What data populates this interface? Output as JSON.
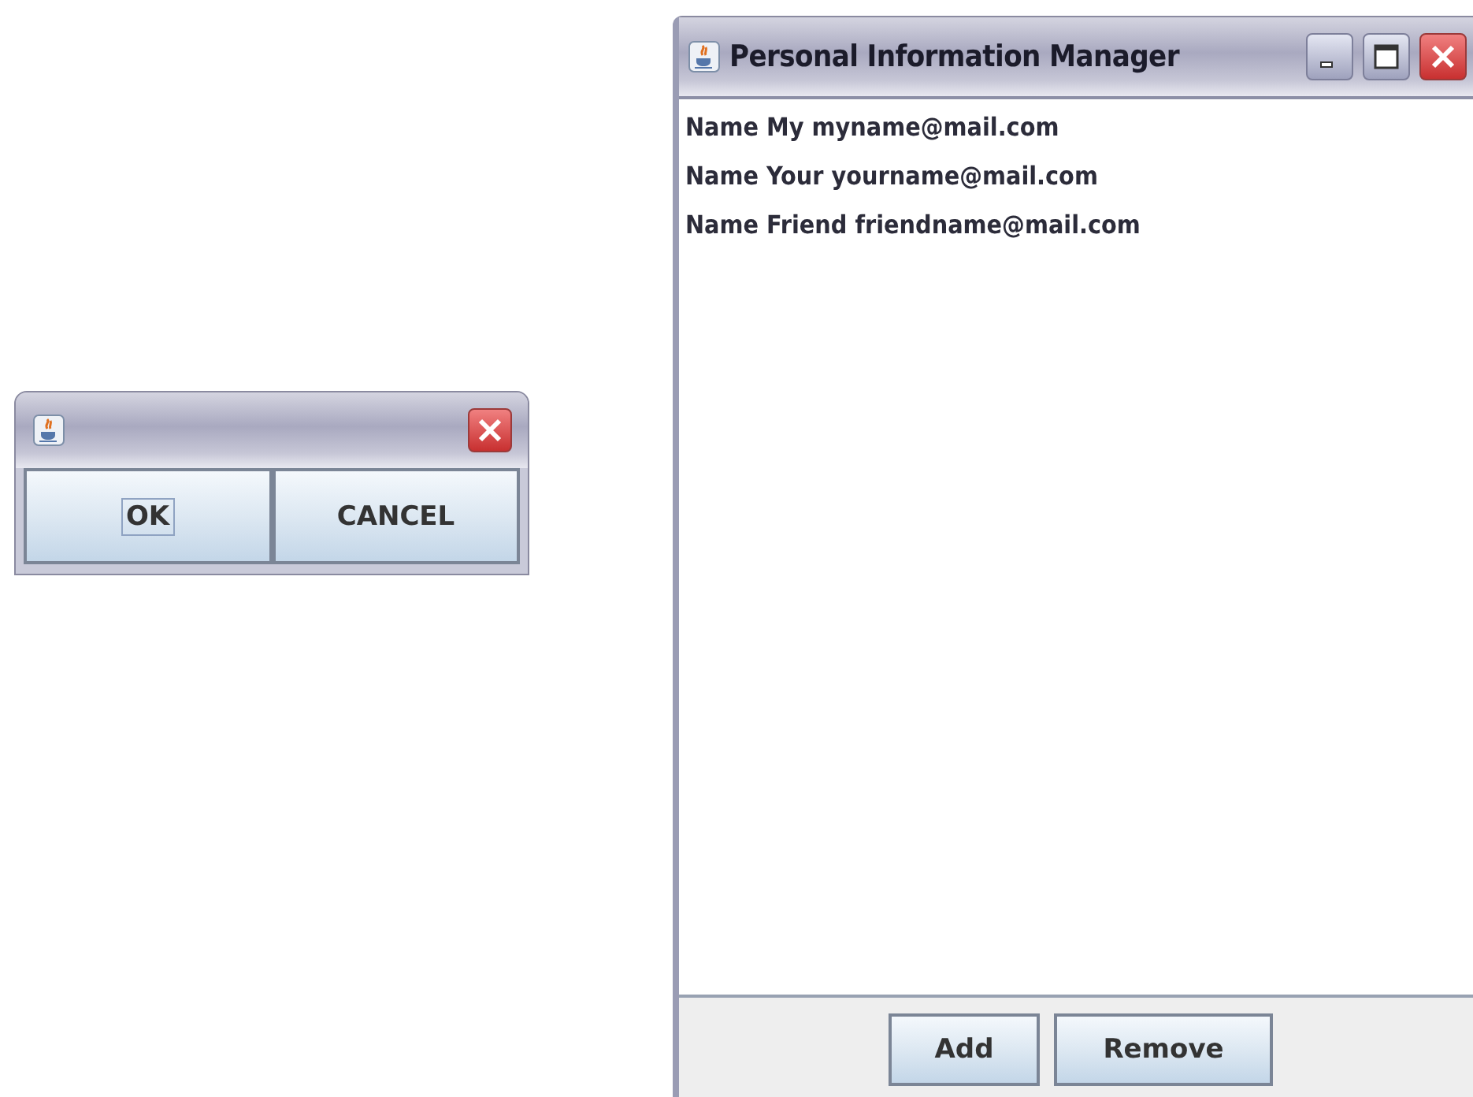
{
  "dialog": {
    "buttons": [
      {
        "label": "OK",
        "focused": true
      },
      {
        "label": "CANCEL",
        "focused": false
      }
    ]
  },
  "main_window": {
    "title": "Personal Information Manager",
    "list": [
      "Name My myname@mail.com",
      "Name Your yourname@mail.com",
      "Name Friend friendname@mail.com"
    ],
    "buttons": [
      "Add",
      "Remove"
    ]
  }
}
